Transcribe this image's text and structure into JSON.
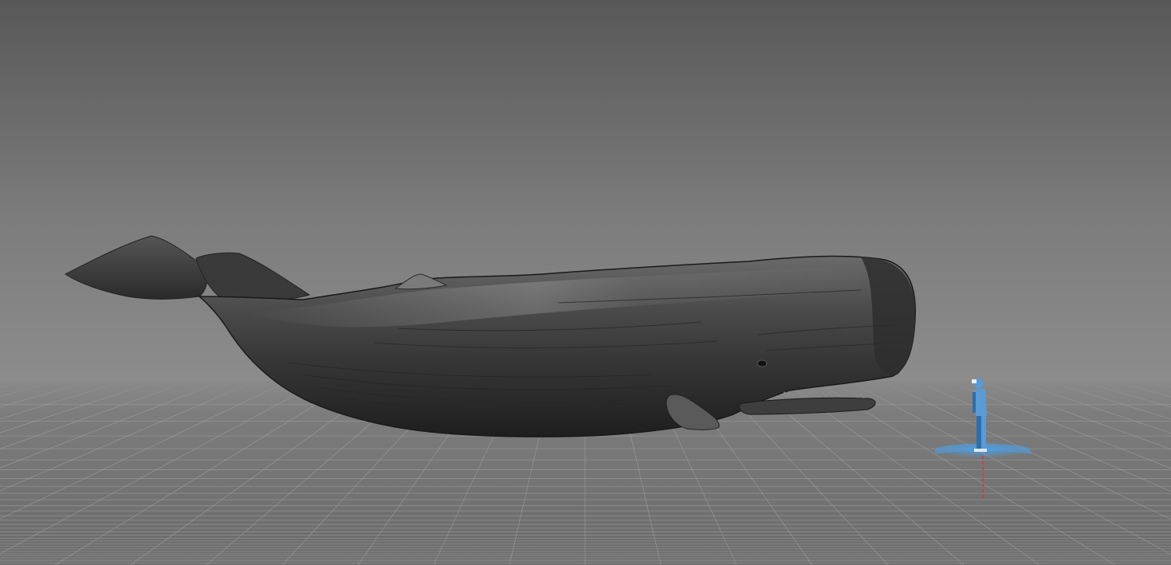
{
  "colors": {
    "sky_top": "#585858",
    "sky_mid": "#7c7c7c",
    "sky_horizon": "#8e8e8e",
    "floor_near": "#6a6a6a",
    "floor_far": "#808080",
    "grid_line": "#a9a9a9",
    "whale_body": "#3c3c3c",
    "whale_highlight": "#8f8f8f",
    "whale_shadow": "#1e1e1e",
    "scale_figure_body": "#5b9bd5",
    "scale_figure_dark": "#2f6fa8",
    "scale_marker_glow": "#4aa0e8",
    "axis_marker": "#e03030"
  },
  "objects": {
    "model": "sperm-whale",
    "scale_reference": "human-figure"
  },
  "icons": {
    "scale_figure": "human-scale-figure-icon",
    "axis": "vertical-axis-marker-icon"
  }
}
